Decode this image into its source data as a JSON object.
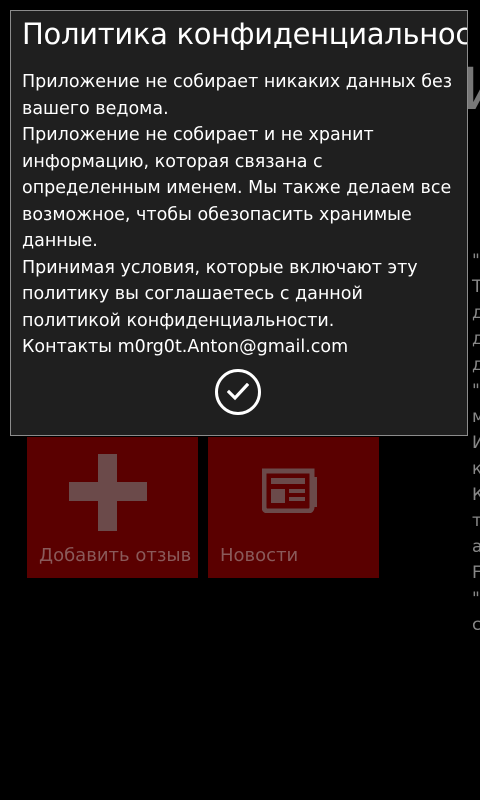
{
  "background": {
    "big_letter": "И",
    "side_fragments": [
      "\"",
      "",
      "T",
      "д",
      "д",
      "д",
      "",
      "\"",
      "м",
      "",
      "И",
      "к",
      "",
      "К",
      "т",
      "а",
      "F",
      "",
      "\"",
      "с"
    ],
    "tiles": [
      {
        "label": "Добавить отзыв",
        "icon": "plus-icon"
      },
      {
        "label": "Новости",
        "icon": "newspaper-icon"
      }
    ],
    "tile_color": "#5a0000"
  },
  "dialog": {
    "title": "Политика конфиденциальности",
    "paragraphs": [
      "Приложение не собирает никаких данных без вашего ведома.",
      "Приложение не собирает и не хранит информацию, которая связана с определенным именем. Мы также делаем все возможное, чтобы обезопасить хранимые данные.",
      "Принимая условия, которые включают эту политику вы соглашаетесь с данной политикой конфиденциальности.",
      "Контакты m0rg0t.Anton@gmail.com"
    ],
    "confirm_icon": "checkmark-icon"
  }
}
